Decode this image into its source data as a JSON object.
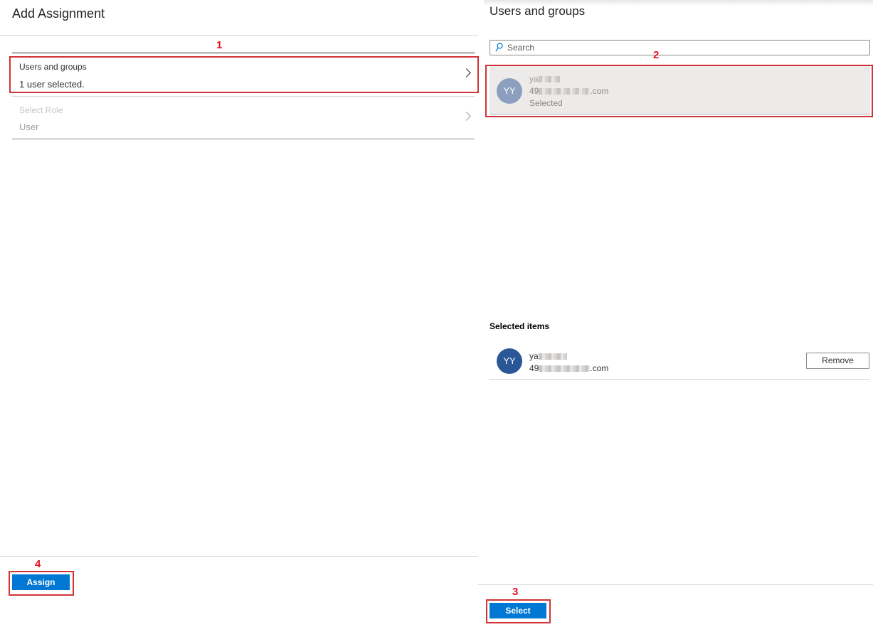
{
  "left_panel": {
    "title": "Add Assignment",
    "users_groups": {
      "label": "Users and groups",
      "value": "1 user selected."
    },
    "select_role": {
      "label": "Select Role",
      "value": "User"
    },
    "assign_button": "Assign"
  },
  "right_panel": {
    "title": "Users and groups",
    "search": {
      "placeholder": "Search",
      "value": ""
    },
    "result": {
      "initials": "YY",
      "name": "ya",
      "email_prefix": "49",
      "email_suffix": ".com",
      "status": "Selected"
    },
    "selected_heading": "Selected items",
    "selected_item": {
      "initials": "YY",
      "name": "ya",
      "email_prefix": "49",
      "email_suffix": ".com",
      "remove_label": "Remove"
    },
    "select_button": "Select"
  },
  "annotations": {
    "n1": "1",
    "n2": "2",
    "n3": "3",
    "n4": "4"
  },
  "colors": {
    "accent": "#0078d4",
    "annotation": "#e81123",
    "avatar_light": "#8d9fbf",
    "avatar_dark": "#2b5797"
  },
  "icons": {
    "search": "search-icon",
    "chevron": "chevron-right-icon"
  }
}
